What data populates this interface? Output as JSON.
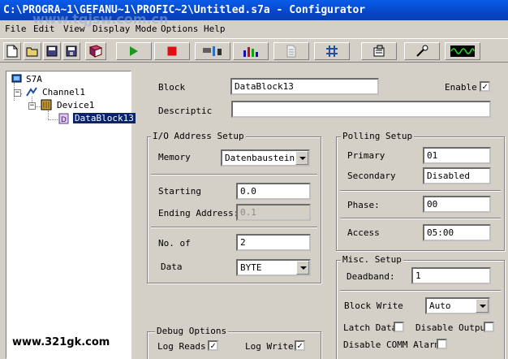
{
  "window": {
    "title": "C:\\PROGRA~1\\GEFANU~1\\PROFIC~2\\Untitled.s7a - Configurator"
  },
  "menu": [
    "File",
    "Edit",
    "View",
    "Display Mode",
    "Options",
    "Help"
  ],
  "tree": {
    "root": "S7A",
    "channel": "Channel1",
    "device": "Device1",
    "block": "DataBlock13"
  },
  "form": {
    "block_label": "Block",
    "block_value": "DataBlock13",
    "enable_label": "Enable",
    "enable_checked": "✓",
    "description_label": "Descriptic",
    "description_value": ""
  },
  "io": {
    "title": "I/O Address Setup",
    "memory_label": "Memory",
    "memory_value": "Datenbaustein",
    "starting_label": "Starting",
    "starting_value": "0.0",
    "ending_label": "Ending Address:",
    "ending_value": "0.1",
    "no_of_label": "No. of",
    "no_of_value": "2",
    "data_label": "Data",
    "data_value": "BYTE"
  },
  "polling": {
    "title": "Polling Setup",
    "primary_label": "Primary",
    "primary_value": "01",
    "secondary_label": "Secondary",
    "secondary_value": "Disabled",
    "phase_label": "Phase:",
    "phase_value": "00",
    "access_label": "Access",
    "access_value": "05:00"
  },
  "misc": {
    "title": "Misc. Setup",
    "deadband_label": "Deadband:",
    "deadband_value": "1",
    "block_write_label": "Block Write",
    "block_write_value": "Auto",
    "latch_label": "Latch Data",
    "disable_output_label": "Disable Output",
    "disable_comm_label": "Disable COMM Alarms"
  },
  "debug": {
    "title": "Debug Options",
    "log_reads_label": "Log Reads",
    "log_reads_checked": "✓",
    "log_writes_label": "Log Writes",
    "log_writes_checked": "✓"
  },
  "watermarks": {
    "top": "www.tqjsw.com.cn",
    "bottom": "www.321gk.com"
  }
}
